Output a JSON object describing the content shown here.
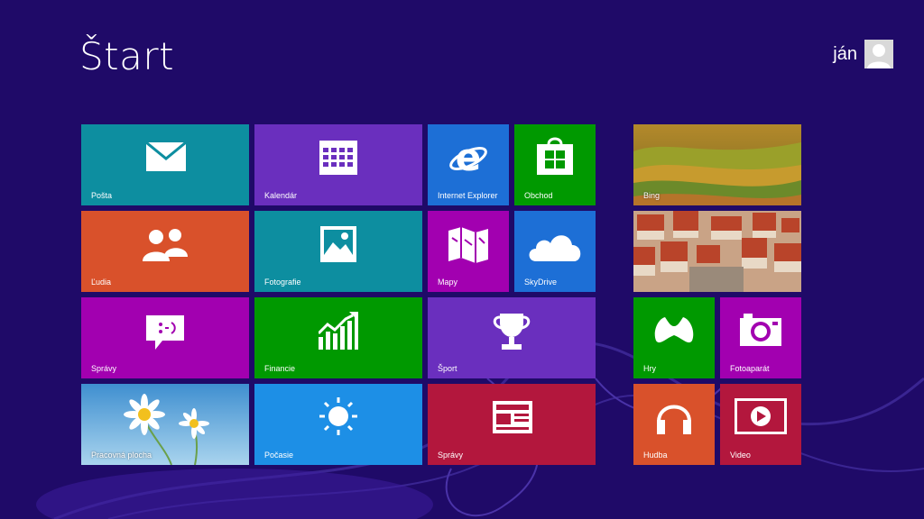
{
  "header": {
    "title": "Štart"
  },
  "user": {
    "name": "ján"
  },
  "tiles": {
    "posta": "Pošta",
    "kalendar": "Kalendár",
    "ie": "Internet Explorer",
    "obchod": "Obchod",
    "bing": "Bing",
    "ludia": "Ľudia",
    "fotografie": "Fotografie",
    "mapy": "Mapy",
    "skydrive": "SkyDrive",
    "spravy_msg": "Správy",
    "financie": "Financie",
    "sport": "Šport",
    "hry": "Hry",
    "fotoaparat": "Fotoaparát",
    "plocha": "Pracovná plocha",
    "pocasie": "Počasie",
    "spravy_news": "Správy",
    "hudba": "Hudba",
    "video": "Video"
  },
  "colors": {
    "background": "#1f0a68",
    "teal": "#0d8ea0",
    "purple": "#6a2fbe",
    "blue": "#1d6fd6",
    "green": "#009900",
    "orange": "#d9512b",
    "magenta": "#a200b0",
    "red": "#b3173d"
  },
  "icons": {
    "posta": "envelope-icon",
    "kalendar": "calendar-icon",
    "ie": "internet-explorer-icon",
    "obchod": "store-bag-icon",
    "ludia": "people-icon",
    "fotografie": "picture-icon",
    "mapy": "map-icon",
    "skydrive": "cloud-icon",
    "spravy_msg": "speech-bubble-icon",
    "financie": "chart-up-icon",
    "sport": "trophy-icon",
    "hry": "game-controller-icon",
    "fotoaparat": "camera-icon",
    "pocasie": "sun-icon",
    "spravy_news": "newspaper-icon",
    "hudba": "headphones-icon",
    "video": "play-icon"
  }
}
